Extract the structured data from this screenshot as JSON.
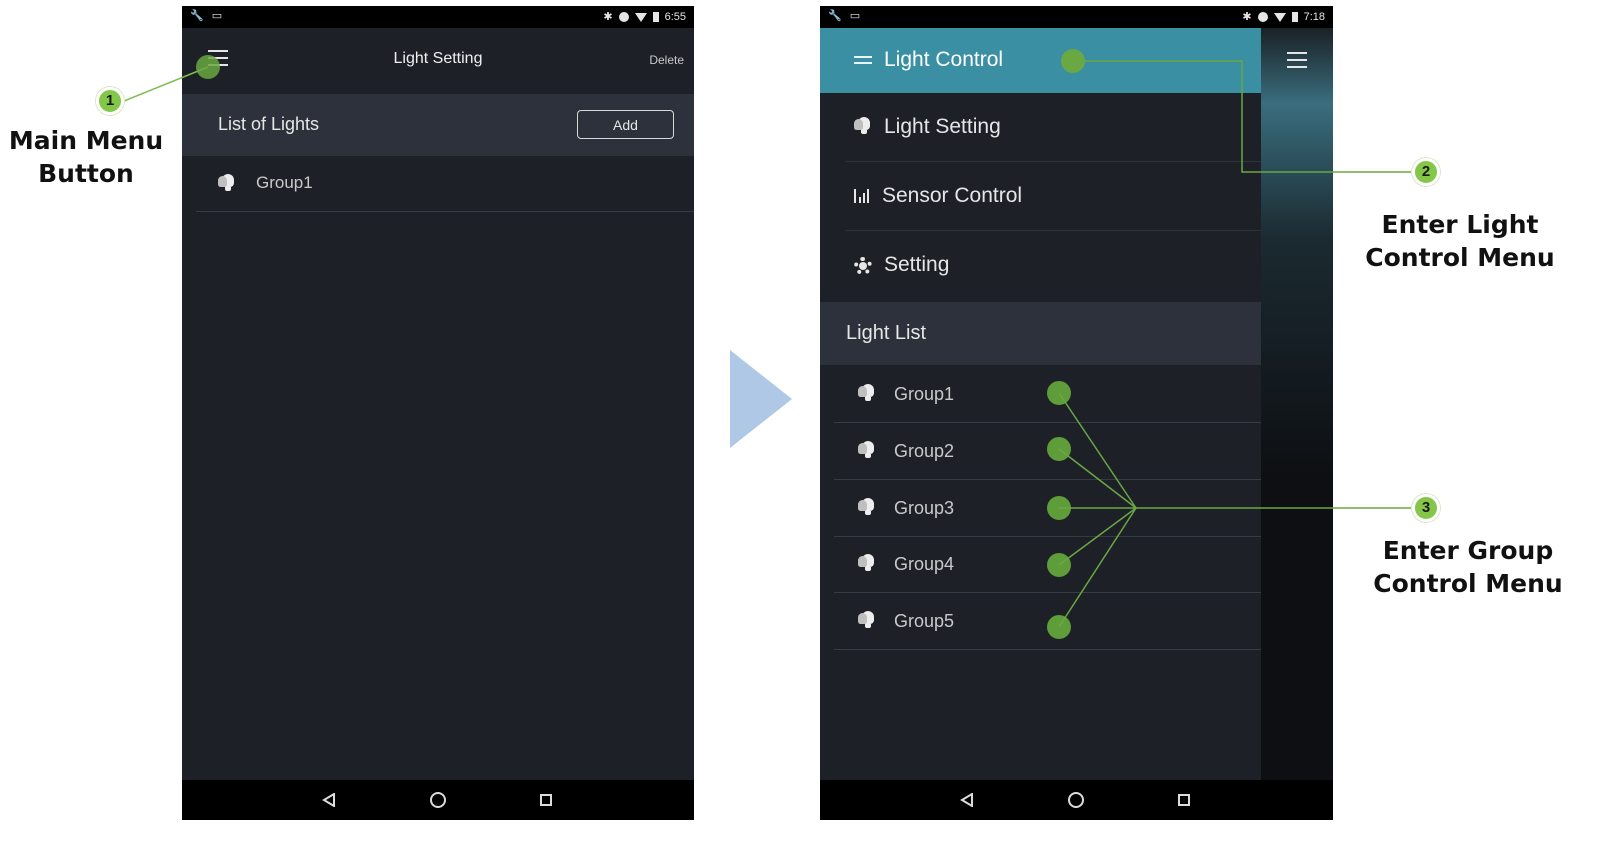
{
  "phone1": {
    "status_time": "6:55",
    "title": "Light Setting",
    "delete_label": "Delete",
    "list_header": "List of Lights",
    "add_label": "Add",
    "items": [
      {
        "label": "Group1"
      }
    ]
  },
  "phone2": {
    "status_time": "7:18",
    "menu": [
      {
        "label": "Light Control",
        "icon": "sliders-icon"
      },
      {
        "label": "Light Setting",
        "icon": "bulb-icon"
      },
      {
        "label": "Sensor Control",
        "icon": "sensor-icon"
      },
      {
        "label": "Setting",
        "icon": "gear-icon"
      }
    ],
    "light_list_header": "Light List",
    "groups": [
      "Group1",
      "Group2",
      "Group3",
      "Group4",
      "Group5"
    ]
  },
  "annotations": {
    "badge1": "1",
    "caption1_line1": "Main Menu",
    "caption1_line2": "Button",
    "badge2": "2",
    "caption2_line1": "Enter Light",
    "caption2_line2": "Control Menu",
    "badge3": "3",
    "caption3_line1": "Enter Group",
    "caption3_line2": "Control Menu"
  },
  "colors": {
    "app_background": "#1d2027",
    "header_band": "#2c313b",
    "drawer_highlight": "#3a8fa3",
    "annotation_green": "#84c748",
    "annotation_line": "#6aa843",
    "arrow": "#aec8e6"
  }
}
